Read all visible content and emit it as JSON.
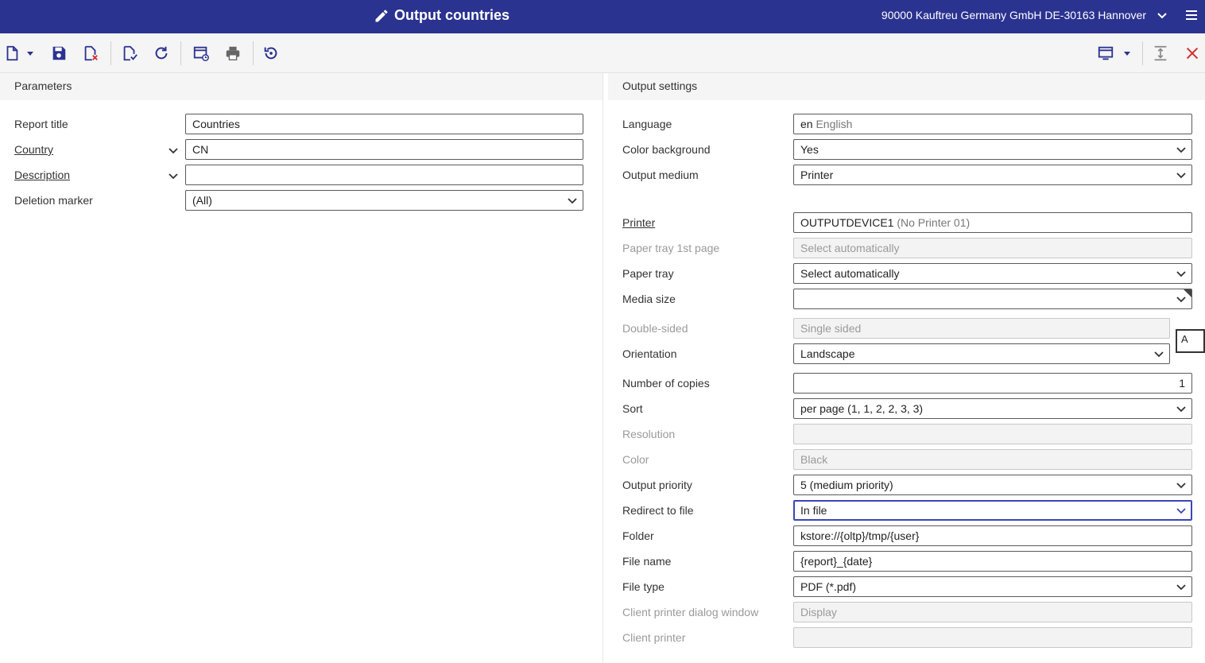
{
  "header": {
    "title": "Output countries",
    "company": "90000  Kauftreu Germany GmbH DE-30163 Hannover"
  },
  "toolbar": {
    "icons": [
      "new-document-icon",
      "dropdown-icon",
      "save-icon",
      "delete-icon",
      "check-document-icon",
      "refresh-icon",
      "schedule-icon",
      "print-icon",
      "reset-icon",
      "view-icon",
      "view-dropdown-icon",
      "expand-icon",
      "close-icon"
    ]
  },
  "parameters": {
    "section_title": "Parameters",
    "report_title": {
      "label": "Report title",
      "value": "Countries"
    },
    "country": {
      "label": "Country",
      "value": "CN"
    },
    "description": {
      "label": "Description",
      "value": ""
    },
    "deletion_marker": {
      "label": "Deletion marker",
      "value": "(All)"
    }
  },
  "output": {
    "section_title": "Output settings",
    "language": {
      "label": "Language",
      "code": "en",
      "value": "English"
    },
    "color_background": {
      "label": "Color background",
      "value": "Yes"
    },
    "output_medium": {
      "label": "Output medium",
      "value": "Printer"
    },
    "printer": {
      "label": "Printer",
      "value": "OUTPUTDEVICE1",
      "sub": "(No Printer 01)"
    },
    "paper_tray_first": {
      "label": "Paper tray 1st page",
      "value": "Select automatically"
    },
    "paper_tray": {
      "label": "Paper tray",
      "value": "Select automatically"
    },
    "media_size": {
      "label": "Media size",
      "value": ""
    },
    "double_sided": {
      "label": "Double-sided",
      "value": "Single sided"
    },
    "orientation": {
      "label": "Orientation",
      "value": "Landscape"
    },
    "copies": {
      "label": "Number of copies",
      "value": "1"
    },
    "sort": {
      "label": "Sort",
      "value": "per page (1, 1, 2, 2, 3, 3)"
    },
    "resolution": {
      "label": "Resolution",
      "value": ""
    },
    "color": {
      "label": "Color",
      "value": "Black"
    },
    "priority": {
      "label": "Output priority",
      "value": "5 (medium priority)"
    },
    "redirect": {
      "label": "Redirect to file",
      "value": "In file"
    },
    "folder": {
      "label": "Folder",
      "value": "kstore://{oltp}/tmp/{user}"
    },
    "file_name": {
      "label": "File name",
      "value": "{report}_{date}"
    },
    "file_type": {
      "label": "File type",
      "value": "PDF (*.pdf)"
    },
    "client_dialog": {
      "label": "Client printer dialog window",
      "value": "Display"
    },
    "client_printer": {
      "label": "Client printer",
      "value": ""
    },
    "side_button": "A"
  }
}
